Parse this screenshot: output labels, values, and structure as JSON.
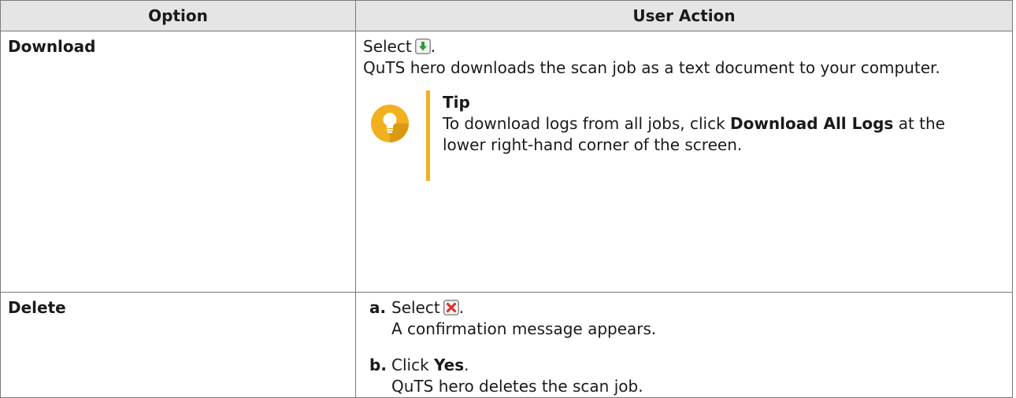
{
  "table": {
    "headers": {
      "option": "Option",
      "action": "User Action"
    },
    "rows": [
      {
        "option": "Download",
        "action": {
          "select_text": "Select",
          "period": ".",
          "icon": "download-icon",
          "description": "QuTS hero downloads the scan job as a text document to your computer.",
          "tip": {
            "icon": "lightbulb-icon",
            "title": "Tip",
            "text_before": "To download logs from all jobs, click",
            "bold": "Download All Logs",
            "text_after": "at the lower right-hand corner of the screen."
          }
        }
      },
      {
        "option": "Delete",
        "steps": [
          {
            "letter": "a.",
            "select_text": "Select",
            "icon": "delete-icon",
            "period": ".",
            "result": "A confirmation message appears."
          },
          {
            "letter": "b.",
            "click_text": "Click",
            "bold": "Yes",
            "period": ".",
            "result": "QuTS hero deletes the scan job."
          }
        ]
      }
    ]
  },
  "colors": {
    "header_bg": "#e5e5e5",
    "border": "#7a7a7a",
    "tip_accent": "#f2b01e",
    "download_icon": "#2e9b3f",
    "delete_icon": "#d9362b"
  }
}
